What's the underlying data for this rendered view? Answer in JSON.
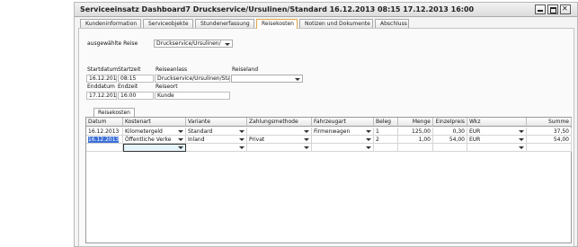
{
  "window": {
    "title": "Serviceeinsatz Dashboard7 Druckservice/Ursulinen/Standard 16.12.2013 08:15 17.12.2013 16:00"
  },
  "tabs": [
    {
      "label": "Kundeninformation"
    },
    {
      "label": "Serviceobjekte"
    },
    {
      "label": "Stundenerfassung"
    },
    {
      "label": "Reisekosten"
    },
    {
      "label": "Notizen und Dokumente"
    },
    {
      "label": "Abschluss"
    }
  ],
  "reise": {
    "label": "ausgewählte Reise",
    "value": "Druckservice/Ursulinen/"
  },
  "form": {
    "startdatum_label": "Startdatum",
    "startzeit_label": "Startzeit",
    "reiseanlass_label": "Reiseanlass",
    "reiseland_label": "Reiseland",
    "startdatum": "16.12.2013",
    "startzeit": "08:15",
    "reiseanlass": "Druckservice/Ursulinen/Sta",
    "enddatum_label": "Enddatum",
    "endzeit_label": "Endzeit",
    "reiseort_label": "Reiseort",
    "enddatum": "17.12.2013",
    "endzeit": "16:00",
    "reiseort": "Kunde"
  },
  "inner_tab": {
    "label": "Reisekosten"
  },
  "table": {
    "headers": [
      "Datum",
      "Kostenart",
      "Variante",
      "Zahlungsmethode",
      "Fahrzeugart",
      "Beleg",
      "Menge",
      "Einzelpreis",
      "Wkz",
      "Summe"
    ],
    "rows": [
      [
        "16.12.2013",
        "Kilometergeld",
        "Standard",
        "",
        "Firmenwagen",
        "1",
        "125,00",
        "0,30",
        "EUR",
        "37,50"
      ],
      [
        "16.12.2013",
        "Öffentliche Verke",
        "Inland",
        "Privat",
        "",
        "2",
        "1,00",
        "54,00",
        "EUR",
        "54,00"
      ]
    ]
  }
}
